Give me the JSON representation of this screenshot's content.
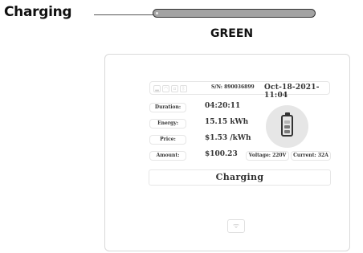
{
  "header": {
    "title": "Charging",
    "led_color_label": "GREEN",
    "led_color": "#a3a3a3"
  },
  "status_bar": {
    "icons": [
      "signal-icon",
      "wifi-icon",
      "ethernet-icon",
      "bluetooth-icon"
    ],
    "serial": "S/N: 890036899",
    "datetime": "Oct-18-2021-11:04"
  },
  "session": {
    "duration_label": "Duration:",
    "duration_value": "04:20:11",
    "energy_label": "Energy:",
    "energy_value": "15.15 kWh",
    "price_label": "Price:",
    "price_value": "$1.53 /kWh",
    "amount_label": "Amount:",
    "amount_value": "$100.23"
  },
  "electrical": {
    "voltage": "Voltage: 220V",
    "current": "Current: 32A"
  },
  "state": "Charging",
  "battery": {
    "level": 0.6
  },
  "nfc_icon": "nfc-icon"
}
